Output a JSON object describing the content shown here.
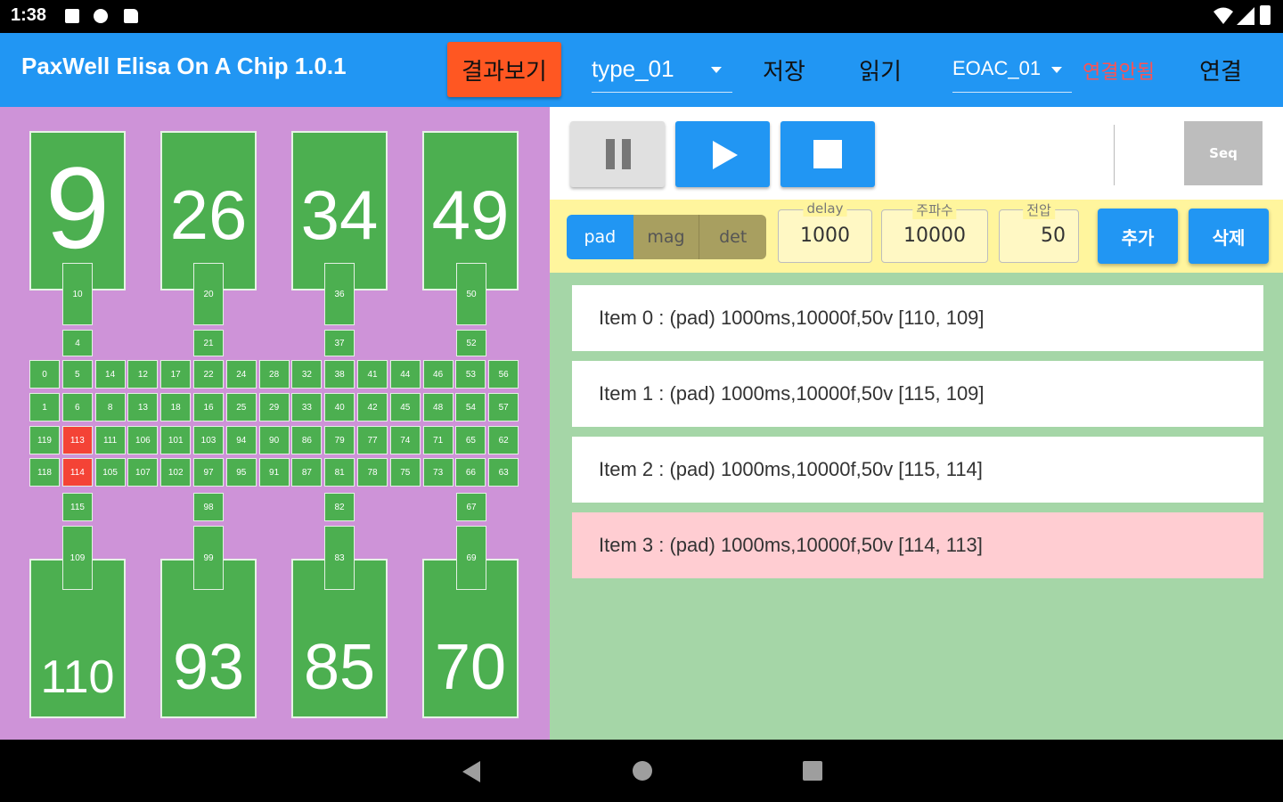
{
  "status_bar": {
    "time": "1:38"
  },
  "appbar": {
    "title": "PaxWell Elisa On A Chip 1.0.1",
    "result_button": "결과보기",
    "type_select": "type_01",
    "save_button": "저장",
    "read_button": "읽기",
    "device_select": "EOAC_01",
    "connection_status": "연결안됨",
    "connect_button": "연결"
  },
  "colors": {
    "appbar": "#2196F3",
    "result_button": "#FF5722",
    "status_text": "#FF5252",
    "left_panel": "#CE93D8",
    "right_panel": "#A5D6A7",
    "param_bar": "#FFF59D",
    "pad": "#4CAF50",
    "pad_active": "#F44336",
    "selected_item": "#FFCDD2"
  },
  "controls": {
    "pause_icon": "pause-icon",
    "play_icon": "play-icon",
    "stop_icon": "stop-icon",
    "seq_button": "Seq"
  },
  "mode_toggle": {
    "options": [
      "pad",
      "mag",
      "det"
    ],
    "selected": "pad"
  },
  "params": {
    "delay": {
      "label": "delay",
      "value": "1000"
    },
    "freq": {
      "label": "주파수",
      "value": "10000"
    },
    "voltage": {
      "label": "전압",
      "value": "50"
    }
  },
  "actions": {
    "add": "추가",
    "delete": "삭제"
  },
  "sequence_items": [
    {
      "text": "Item 0 : (pad) 1000ms,10000f,50v  [110, 109]",
      "selected": false
    },
    {
      "text": "Item 1 : (pad) 1000ms,10000f,50v  [115, 109]",
      "selected": false
    },
    {
      "text": "Item 2 : (pad) 1000ms,10000f,50v  [115, 114]",
      "selected": false
    },
    {
      "text": "Item 3 : (pad) 1000ms,10000f,50v  [114, 113]",
      "selected": true
    }
  ],
  "chip": {
    "top_reservoirs": [
      "9",
      "26",
      "34",
      "49"
    ],
    "bottom_reservoirs": [
      "110",
      "93",
      "85",
      "70"
    ],
    "top_channel_a": [
      "10",
      "20",
      "36",
      "50"
    ],
    "top_channel_b": [
      "4",
      "21",
      "37",
      "52"
    ],
    "bottom_channel_a": [
      "115",
      "98",
      "82",
      "67"
    ],
    "bottom_channel_b": [
      "109",
      "99",
      "83",
      "69"
    ],
    "grid_rows": [
      [
        "0",
        "5",
        "14",
        "12",
        "17",
        "22",
        "24",
        "28",
        "32",
        "38",
        "41",
        "44",
        "46",
        "53",
        "56"
      ],
      [
        "1",
        "6",
        "8",
        "13",
        "18",
        "16",
        "25",
        "29",
        "33",
        "40",
        "42",
        "45",
        "48",
        "54",
        "57"
      ],
      [
        "119",
        "113",
        "111",
        "106",
        "101",
        "103",
        "94",
        "90",
        "86",
        "79",
        "77",
        "74",
        "71",
        "65",
        "62"
      ],
      [
        "118",
        "114",
        "105",
        "107",
        "102",
        "97",
        "95",
        "91",
        "87",
        "81",
        "78",
        "75",
        "73",
        "66",
        "63"
      ]
    ],
    "active_pads": [
      "113",
      "114"
    ]
  },
  "navbar": {
    "back": "back-icon",
    "home": "home-icon",
    "recents": "recents-icon"
  }
}
